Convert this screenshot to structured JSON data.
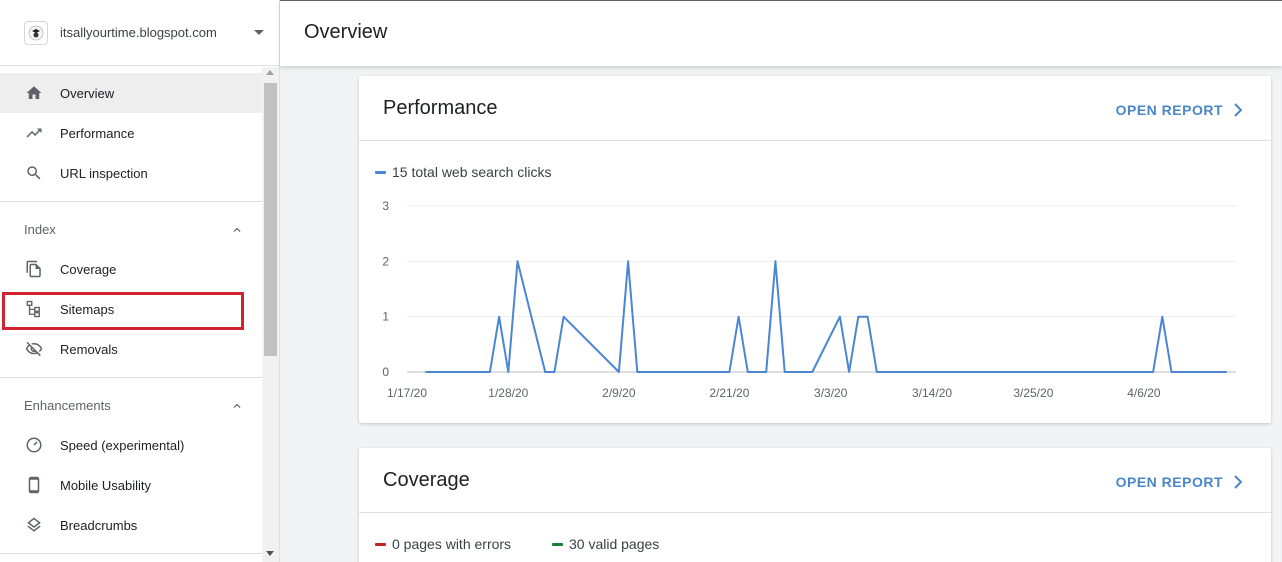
{
  "property": {
    "name": "itsallyourtime.blogspot.com"
  },
  "header": {
    "title": "Overview"
  },
  "sidebar": {
    "items_top": [
      {
        "label": "Overview",
        "icon": "home-icon",
        "active": true
      },
      {
        "label": "Performance",
        "icon": "trending-up-icon"
      },
      {
        "label": "URL inspection",
        "icon": "search-icon"
      }
    ],
    "index_section": {
      "label": "Index",
      "items": [
        {
          "label": "Coverage",
          "icon": "coverage-icon"
        },
        {
          "label": "Sitemaps",
          "icon": "sitemap-icon",
          "highlighted": true
        },
        {
          "label": "Removals",
          "icon": "removals-icon"
        }
      ]
    },
    "enhancements_section": {
      "label": "Enhancements",
      "items": [
        {
          "label": "Speed (experimental)",
          "icon": "speedometer-icon"
        },
        {
          "label": "Mobile Usability",
          "icon": "phone-icon"
        },
        {
          "label": "Breadcrumbs",
          "icon": "layers-icon"
        }
      ]
    }
  },
  "performance_card": {
    "title": "Performance",
    "open_report": "OPEN REPORT",
    "legend": "15 total web search clicks",
    "legend_color": "#4a86d4"
  },
  "coverage_card": {
    "title": "Coverage",
    "open_report": "OPEN REPORT",
    "legend_errors": "0 pages with errors",
    "legend_errors_color": "#c5221f",
    "legend_valid": "30 valid pages",
    "legend_valid_color": "#188038"
  },
  "chart_data": {
    "type": "line",
    "y_ticks": [
      "0",
      "1",
      "2",
      "3"
    ],
    "ylim": [
      0,
      3
    ],
    "x_tick_labels": [
      "1/17/20",
      "1/28/20",
      "2/9/20",
      "2/21/20",
      "3/3/20",
      "3/14/20",
      "3/25/20",
      "4/6/20"
    ],
    "grid": true,
    "series": [
      {
        "name": "",
        "color": "#4a86d4",
        "x": [
          "1/19/20",
          "1/26/20",
          "1/27/20",
          "1/28/20",
          "1/29/20",
          "2/1/20",
          "2/2/20",
          "2/3/20",
          "2/9/20",
          "2/10/20",
          "2/11/20",
          "2/14/20",
          "2/21/20",
          "2/22/20",
          "2/23/20",
          "2/25/20",
          "2/26/20",
          "2/27/20",
          "2/28/20",
          "3/1/20",
          "3/4/20",
          "3/5/20",
          "3/6/20",
          "3/7/20",
          "3/8/20",
          "3/9/20",
          "3/10/20",
          "4/7/20",
          "4/8/20",
          "4/9/20",
          "4/15/20"
        ],
        "y": [
          0,
          0,
          1,
          0,
          2,
          0,
          0,
          1,
          0,
          2,
          0,
          0,
          0,
          1,
          0,
          0,
          2,
          0,
          0,
          0,
          1,
          0,
          1,
          1,
          0,
          0,
          0,
          0,
          1,
          0,
          0
        ]
      }
    ]
  }
}
